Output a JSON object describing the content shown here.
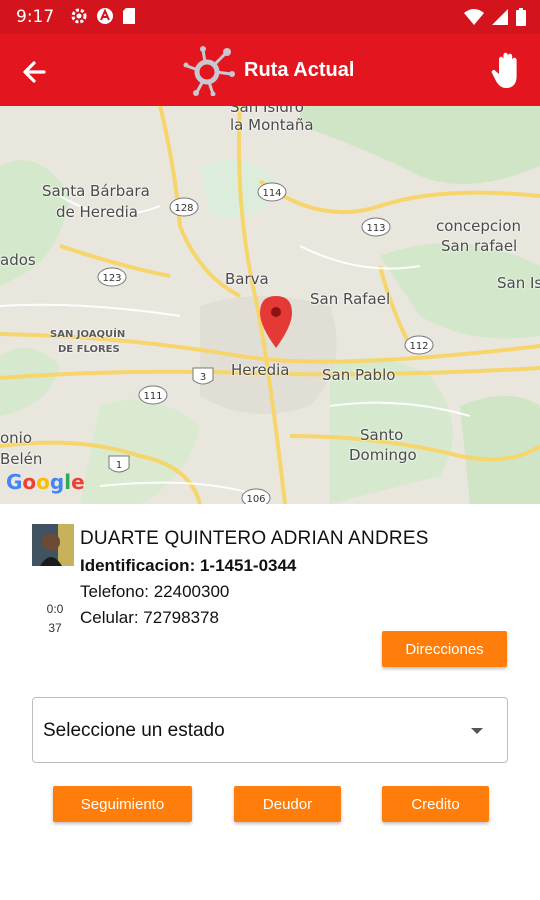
{
  "status_bar": {
    "time": "9:17"
  },
  "app_bar": {
    "title": "Ruta Actual"
  },
  "map": {
    "labels": {
      "san_isidro": "San Isidro",
      "la_montana": "la Montaña",
      "santa_barbara": "Santa Bárbara",
      "de_heredia": "de Heredia",
      "concepcion": "concepcion",
      "san_rafael_lc": "San rafael",
      "ados": "ados",
      "san_is": "San Is",
      "barva": "Barva",
      "san_rafael": "San Rafael",
      "san_joaquin": "SAN JOAQUÍN",
      "de_flores": "DE FLORES",
      "heredia": "Heredia",
      "san_pablo": "San Pablo",
      "santo": "Santo",
      "domingo": "Domingo",
      "onio": "onio",
      "belen": "Belén"
    },
    "route_shields": [
      "114",
      "128",
      "113",
      "123",
      "112",
      "3",
      "111",
      "1",
      "106"
    ],
    "attribution": "Google"
  },
  "client": {
    "name": "DUARTE QUINTERO ADRIAN ANDRES",
    "id_label": "Identificacion:",
    "id_value": "1-1451-0344",
    "phone_line": "Telefono: 22400300",
    "mobile_line": "Celular: 72798378",
    "timer_line1": "0:0",
    "timer_line2": "37"
  },
  "buttons": {
    "directions": "Direcciones",
    "follow_up": "Seguimiento",
    "debtor": "Deudor",
    "credit": "Credito"
  },
  "status_select": {
    "placeholder": "Seleccione un estado"
  },
  "colors": {
    "primary": "#e3161f",
    "accent": "#ff7d0a",
    "status_bar": "#d4141c"
  }
}
